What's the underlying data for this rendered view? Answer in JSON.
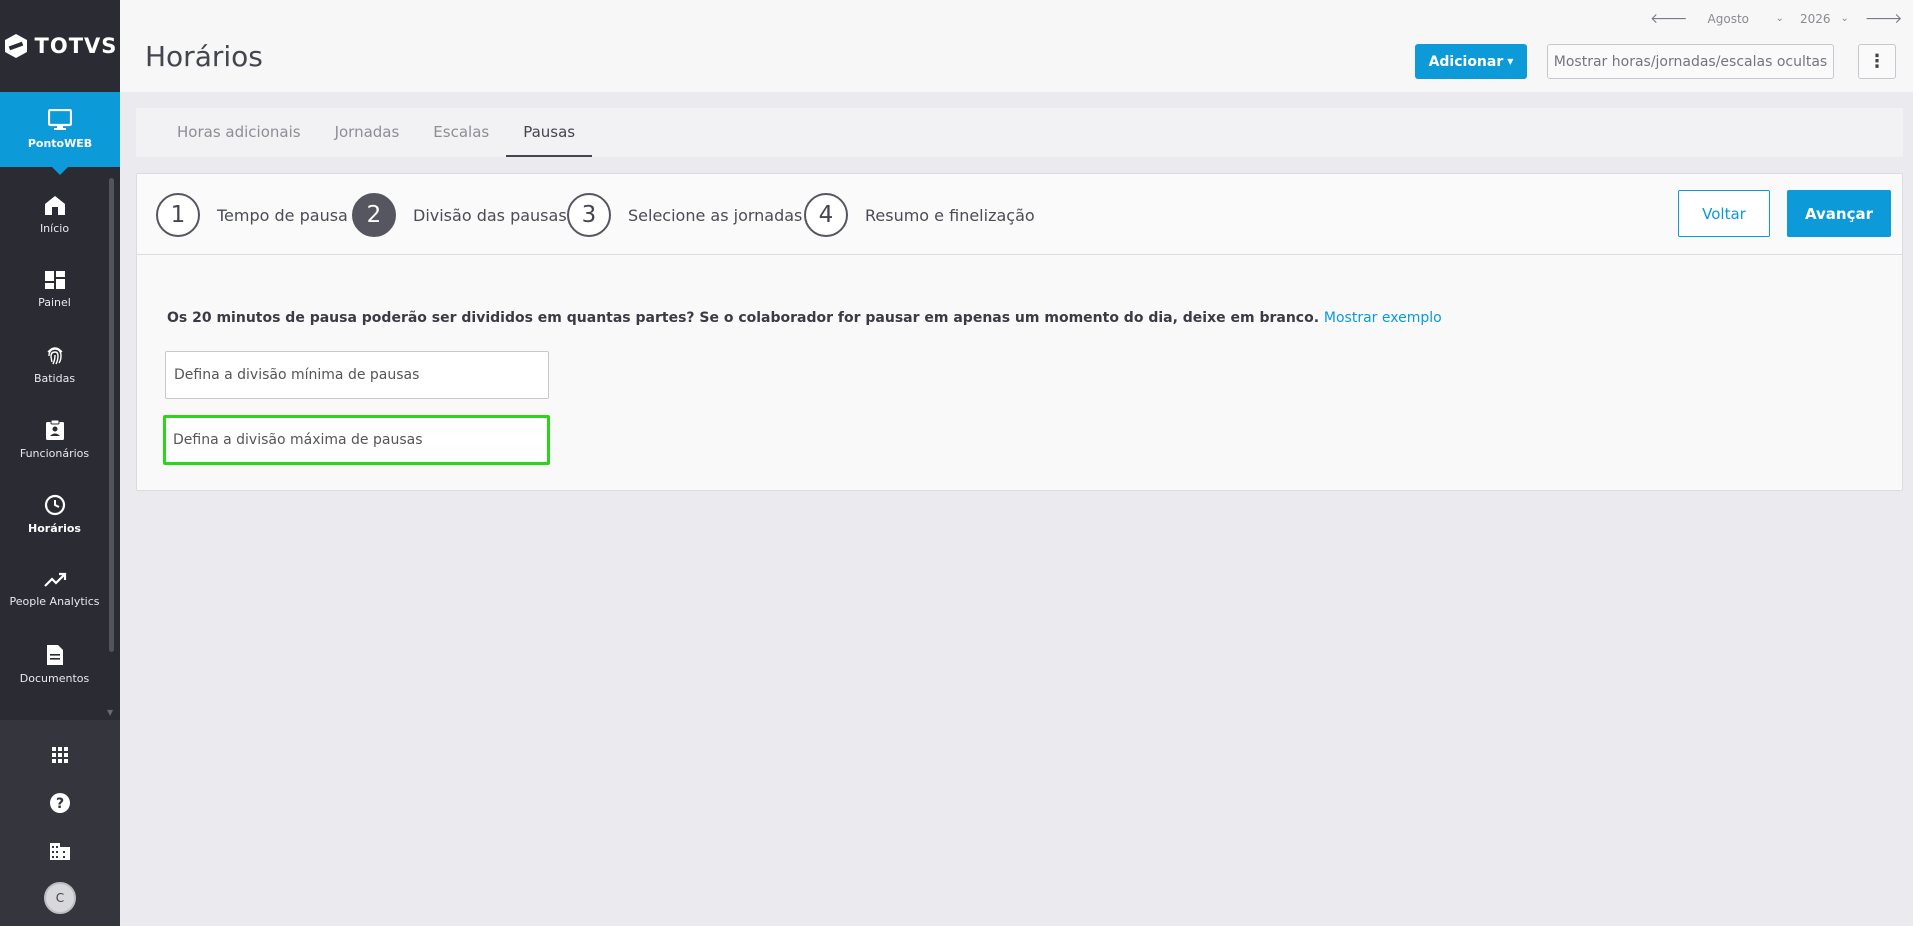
{
  "brand": {
    "name": "TOTVS"
  },
  "sidebar": {
    "module": {
      "label": "PontoWEB",
      "icon": "monitor-icon"
    },
    "items": [
      {
        "label": "Início",
        "icon": "home-icon",
        "active": false
      },
      {
        "label": "Painel",
        "icon": "dashboard-icon",
        "active": false
      },
      {
        "label": "Batidas",
        "icon": "fingerprint-icon",
        "active": false
      },
      {
        "label": "Funcionários",
        "icon": "badge-icon",
        "active": false
      },
      {
        "label": "Horários",
        "icon": "clock-icon",
        "active": true
      },
      {
        "label": "People Analytics",
        "icon": "trending-icon",
        "active": false
      },
      {
        "label": "Documentos",
        "icon": "document-icon",
        "active": false
      }
    ],
    "bottom": {
      "apps_icon": "apps-grid-icon",
      "help_icon": "help-icon",
      "company_icon": "building-icon",
      "avatar_initial": "C"
    }
  },
  "header": {
    "title": "Horários",
    "period": {
      "month": "Agosto",
      "year": "2026"
    },
    "add_button": "Adicionar",
    "hidden_button": "Mostrar horas/jornadas/escalas ocultas"
  },
  "tabs": [
    {
      "label": "Horas adicionais",
      "active": false
    },
    {
      "label": "Jornadas",
      "active": false
    },
    {
      "label": "Escalas",
      "active": false
    },
    {
      "label": "Pausas",
      "active": true
    }
  ],
  "wizard": {
    "steps": [
      {
        "number": "1",
        "label": "Tempo de pausa",
        "active": false
      },
      {
        "number": "2",
        "label": "Divisão das pausas",
        "active": true
      },
      {
        "number": "3",
        "label": "Selecione as jornadas",
        "active": false
      },
      {
        "number": "4",
        "label": "Resumo e finelização",
        "active": false
      }
    ],
    "back_button": "Voltar",
    "next_button": "Avançar",
    "question": "Os 20 minutos de pausa poderão ser divididos em quantas partes? Se o colaborador for pausar em apenas um momento do dia, deixe em branco.",
    "example_link": "Mostrar exemplo",
    "min_field": {
      "placeholder": "Defina a divisão mínima de pausas",
      "value": ""
    },
    "max_field": {
      "placeholder": "Defina a divisão máxima de pausas",
      "value": ""
    }
  },
  "colors": {
    "primary": "#0c9ad8",
    "sidebar": "#2b2b33",
    "highlight": "#2bd61a"
  }
}
